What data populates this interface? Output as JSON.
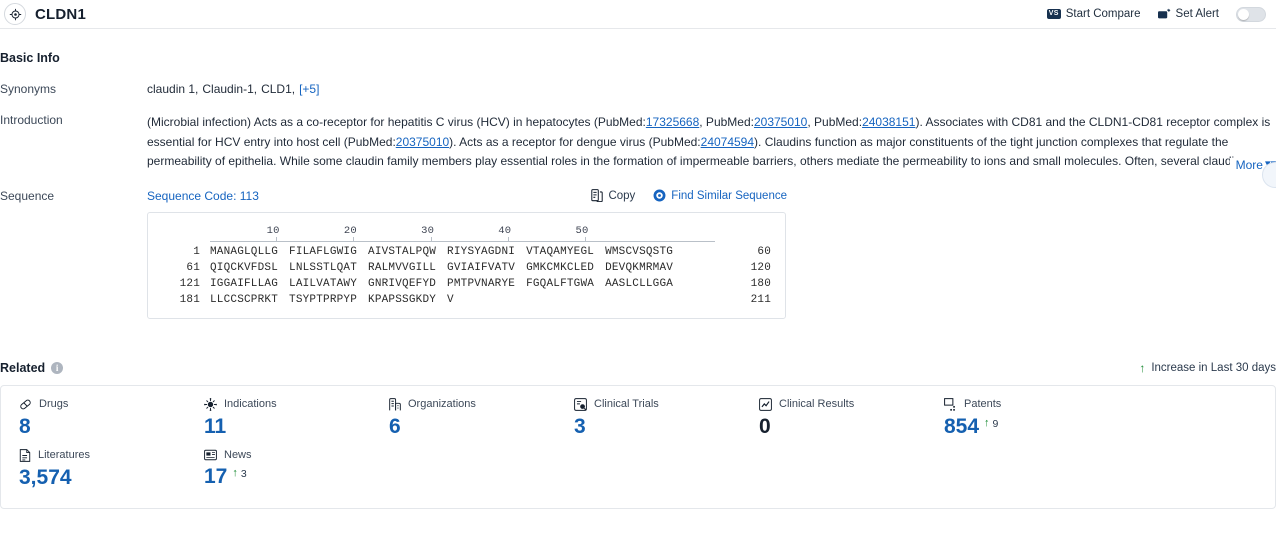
{
  "header": {
    "title": "CLDN1",
    "target_icon": "target-icon",
    "start_compare": "Start Compare",
    "vs_badge": "VS",
    "set_alert": "Set Alert",
    "alert_toggle_state": "off"
  },
  "basic_info": {
    "section_title": "Basic Info",
    "synonyms_label": "Synonyms",
    "synonyms": [
      "claudin 1,",
      "Claudin-1,",
      "CLD1,"
    ],
    "synonyms_more": "[+5]",
    "introduction_label": "Introduction",
    "introduction_parts": [
      {
        "type": "text",
        "text": "(Microbial infection) Acts as a co-receptor for hepatitis C virus (HCV) in hepatocytes (PubMed:"
      },
      {
        "type": "link",
        "text": "17325668"
      },
      {
        "type": "text",
        "text": ", PubMed:"
      },
      {
        "type": "link",
        "text": "20375010"
      },
      {
        "type": "text",
        "text": ", PubMed:"
      },
      {
        "type": "link",
        "text": "24038151"
      },
      {
        "type": "text",
        "text": "). Associates with CD81 and the CLDN1-CD81 receptor complex is essential for HCV entry into host cell (PubMed:"
      },
      {
        "type": "link",
        "text": "20375010"
      },
      {
        "type": "text",
        "text": "). Acts as a receptor for dengue virus (PubMed:"
      },
      {
        "type": "link",
        "text": "24074594"
      },
      {
        "type": "text",
        "text": "). Claudins function as major constituents of the tight junction complexes that regulate the permeability of epithelia. While some claudin family members play essential roles in the formation of impermeable barriers, others mediate the permeability to ions and small molecules. Often, several claudin family members are coexpressed and interact with each other, and this may modify the barrier function."
      }
    ],
    "more_label": "More",
    "more_chevron": "chevron-down-icon",
    "sequence_label": "Sequence",
    "sequence_code": "Sequence Code: 113",
    "copy_label": "Copy",
    "copy_icon": "copy-icon",
    "find_similar_label": "Find Similar Sequence",
    "find_similar_icon": "target-icon"
  },
  "sequence": {
    "ruler_ticks": [
      10,
      20,
      30,
      40,
      50
    ],
    "rows": [
      {
        "start": "1",
        "chunks": [
          "MANAGLQLLG",
          "FILAFLGWIG",
          "AIVSTALPQW",
          "RIYSYAGDNI",
          "VTAQAMYEGL",
          "WMSCVSQSTG"
        ],
        "end": "60"
      },
      {
        "start": "61",
        "chunks": [
          "QIQCKVFDSL",
          "LNLSSTLQAT",
          "RALMVVGILL",
          "GVIAIFVATV",
          "GMKCMKCLED",
          "DEVQKMRMAV"
        ],
        "end": "120"
      },
      {
        "start": "121",
        "chunks": [
          "IGGAIFLLAG",
          "LAILVATAWY",
          "GNRIVQEFYD",
          "PMTPVNARYE",
          "FGQALFTGWA",
          "AASLCLLGGA"
        ],
        "end": "180"
      },
      {
        "start": "181",
        "chunks": [
          "LLCCSCPRKT",
          "TSYPTPRPYP",
          "KPAPSSGKDY",
          "V"
        ],
        "end": "211"
      }
    ]
  },
  "related": {
    "title": "Related",
    "info_icon": "info-icon",
    "info_glyph": "i",
    "legend_text": "Increase in Last 30 days",
    "legend_arrow": "arrow-up-icon",
    "cards": [
      {
        "label": "Drugs",
        "icon": "pill-icon",
        "value": "8",
        "delta": null
      },
      {
        "label": "Indications",
        "icon": "virus-icon",
        "value": "11",
        "delta": null
      },
      {
        "label": "Organizations",
        "icon": "building-icon",
        "value": "6",
        "delta": null
      },
      {
        "label": "Clinical Trials",
        "icon": "clinical-trial-icon",
        "value": "3",
        "delta": null
      },
      {
        "label": "Clinical Results",
        "icon": "clinical-result-icon",
        "value": "0",
        "delta": null,
        "zero": true
      },
      {
        "label": "Patents",
        "icon": "patent-icon",
        "value": "854",
        "delta": "9"
      },
      {
        "label": "Literatures",
        "icon": "literature-icon",
        "value": "3,574",
        "delta": null
      },
      {
        "label": "News",
        "icon": "news-icon",
        "value": "17",
        "delta": "3"
      }
    ]
  },
  "colors": {
    "link_blue": "#1664c0",
    "value_blue": "#1560b0",
    "increase_green": "#1a8a33",
    "title_dark": "#16202e"
  }
}
